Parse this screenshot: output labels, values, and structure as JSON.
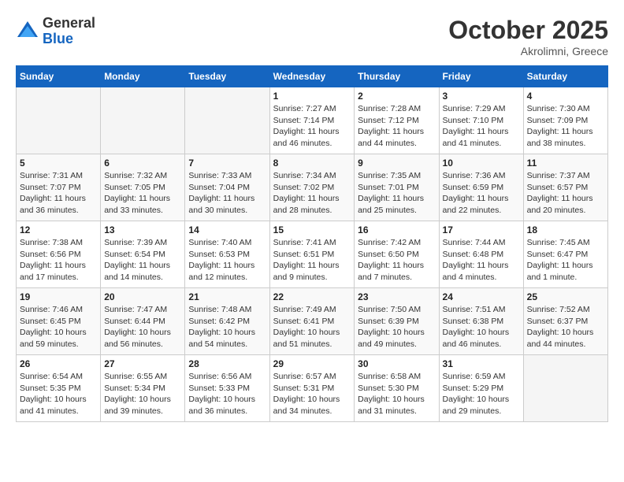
{
  "logo": {
    "general": "General",
    "blue": "Blue"
  },
  "title": "October 2025",
  "location": "Akrolimni, Greece",
  "days_of_week": [
    "Sunday",
    "Monday",
    "Tuesday",
    "Wednesday",
    "Thursday",
    "Friday",
    "Saturday"
  ],
  "weeks": [
    [
      {
        "day": "",
        "info": ""
      },
      {
        "day": "",
        "info": ""
      },
      {
        "day": "",
        "info": ""
      },
      {
        "day": "1",
        "info": "Sunrise: 7:27 AM\nSunset: 7:14 PM\nDaylight: 11 hours and 46 minutes."
      },
      {
        "day": "2",
        "info": "Sunrise: 7:28 AM\nSunset: 7:12 PM\nDaylight: 11 hours and 44 minutes."
      },
      {
        "day": "3",
        "info": "Sunrise: 7:29 AM\nSunset: 7:10 PM\nDaylight: 11 hours and 41 minutes."
      },
      {
        "day": "4",
        "info": "Sunrise: 7:30 AM\nSunset: 7:09 PM\nDaylight: 11 hours and 38 minutes."
      }
    ],
    [
      {
        "day": "5",
        "info": "Sunrise: 7:31 AM\nSunset: 7:07 PM\nDaylight: 11 hours and 36 minutes."
      },
      {
        "day": "6",
        "info": "Sunrise: 7:32 AM\nSunset: 7:05 PM\nDaylight: 11 hours and 33 minutes."
      },
      {
        "day": "7",
        "info": "Sunrise: 7:33 AM\nSunset: 7:04 PM\nDaylight: 11 hours and 30 minutes."
      },
      {
        "day": "8",
        "info": "Sunrise: 7:34 AM\nSunset: 7:02 PM\nDaylight: 11 hours and 28 minutes."
      },
      {
        "day": "9",
        "info": "Sunrise: 7:35 AM\nSunset: 7:01 PM\nDaylight: 11 hours and 25 minutes."
      },
      {
        "day": "10",
        "info": "Sunrise: 7:36 AM\nSunset: 6:59 PM\nDaylight: 11 hours and 22 minutes."
      },
      {
        "day": "11",
        "info": "Sunrise: 7:37 AM\nSunset: 6:57 PM\nDaylight: 11 hours and 20 minutes."
      }
    ],
    [
      {
        "day": "12",
        "info": "Sunrise: 7:38 AM\nSunset: 6:56 PM\nDaylight: 11 hours and 17 minutes."
      },
      {
        "day": "13",
        "info": "Sunrise: 7:39 AM\nSunset: 6:54 PM\nDaylight: 11 hours and 14 minutes."
      },
      {
        "day": "14",
        "info": "Sunrise: 7:40 AM\nSunset: 6:53 PM\nDaylight: 11 hours and 12 minutes."
      },
      {
        "day": "15",
        "info": "Sunrise: 7:41 AM\nSunset: 6:51 PM\nDaylight: 11 hours and 9 minutes."
      },
      {
        "day": "16",
        "info": "Sunrise: 7:42 AM\nSunset: 6:50 PM\nDaylight: 11 hours and 7 minutes."
      },
      {
        "day": "17",
        "info": "Sunrise: 7:44 AM\nSunset: 6:48 PM\nDaylight: 11 hours and 4 minutes."
      },
      {
        "day": "18",
        "info": "Sunrise: 7:45 AM\nSunset: 6:47 PM\nDaylight: 11 hours and 1 minute."
      }
    ],
    [
      {
        "day": "19",
        "info": "Sunrise: 7:46 AM\nSunset: 6:45 PM\nDaylight: 10 hours and 59 minutes."
      },
      {
        "day": "20",
        "info": "Sunrise: 7:47 AM\nSunset: 6:44 PM\nDaylight: 10 hours and 56 minutes."
      },
      {
        "day": "21",
        "info": "Sunrise: 7:48 AM\nSunset: 6:42 PM\nDaylight: 10 hours and 54 minutes."
      },
      {
        "day": "22",
        "info": "Sunrise: 7:49 AM\nSunset: 6:41 PM\nDaylight: 10 hours and 51 minutes."
      },
      {
        "day": "23",
        "info": "Sunrise: 7:50 AM\nSunset: 6:39 PM\nDaylight: 10 hours and 49 minutes."
      },
      {
        "day": "24",
        "info": "Sunrise: 7:51 AM\nSunset: 6:38 PM\nDaylight: 10 hours and 46 minutes."
      },
      {
        "day": "25",
        "info": "Sunrise: 7:52 AM\nSunset: 6:37 PM\nDaylight: 10 hours and 44 minutes."
      }
    ],
    [
      {
        "day": "26",
        "info": "Sunrise: 6:54 AM\nSunset: 5:35 PM\nDaylight: 10 hours and 41 minutes."
      },
      {
        "day": "27",
        "info": "Sunrise: 6:55 AM\nSunset: 5:34 PM\nDaylight: 10 hours and 39 minutes."
      },
      {
        "day": "28",
        "info": "Sunrise: 6:56 AM\nSunset: 5:33 PM\nDaylight: 10 hours and 36 minutes."
      },
      {
        "day": "29",
        "info": "Sunrise: 6:57 AM\nSunset: 5:31 PM\nDaylight: 10 hours and 34 minutes."
      },
      {
        "day": "30",
        "info": "Sunrise: 6:58 AM\nSunset: 5:30 PM\nDaylight: 10 hours and 31 minutes."
      },
      {
        "day": "31",
        "info": "Sunrise: 6:59 AM\nSunset: 5:29 PM\nDaylight: 10 hours and 29 minutes."
      },
      {
        "day": "",
        "info": ""
      }
    ]
  ]
}
